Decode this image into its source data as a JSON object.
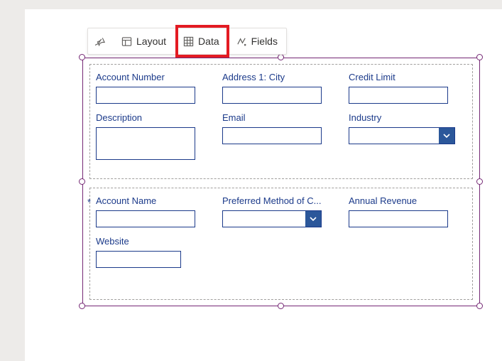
{
  "toolbar": {
    "layout_label": "Layout",
    "data_label": "Data",
    "fields_label": "Fields"
  },
  "form": {
    "group1": {
      "fields": [
        {
          "label": "Account Number"
        },
        {
          "label": "Address 1: City"
        },
        {
          "label": "Credit Limit"
        },
        {
          "label": "Description"
        },
        {
          "label": "Email"
        },
        {
          "label": "Industry"
        }
      ]
    },
    "group2": {
      "fields": [
        {
          "label": "Account Name",
          "required_mark": "*"
        },
        {
          "label": "Preferred Method of C..."
        },
        {
          "label": "Annual Revenue"
        },
        {
          "label": "Website"
        }
      ]
    }
  }
}
